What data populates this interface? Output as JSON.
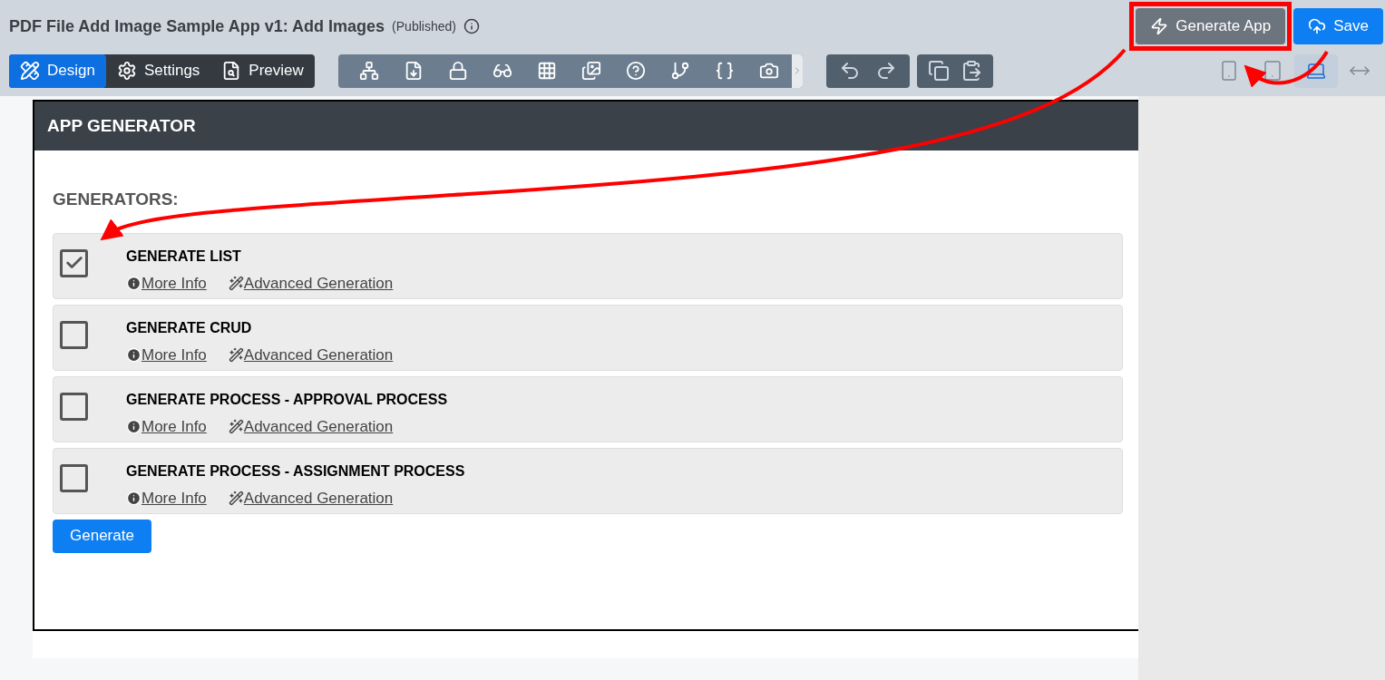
{
  "header": {
    "title": "PDF File Add Image Sample App v1: Add Images",
    "status": "(Published)"
  },
  "actions": [
    {
      "kind": "generate",
      "label": "Generate App",
      "highlighted": true
    },
    {
      "kind": "save",
      "label": "Save",
      "highlighted": false
    }
  ],
  "mode_tabs": [
    {
      "kind": "design",
      "label": "Design",
      "selected": true
    },
    {
      "kind": "settings",
      "label": "Settings",
      "selected": false
    },
    {
      "kind": "preview",
      "label": "Preview",
      "selected": false
    }
  ],
  "devices": [
    {
      "kind": "phone",
      "selected": false
    },
    {
      "kind": "tablet",
      "selected": false
    },
    {
      "kind": "laptop",
      "selected": true
    },
    {
      "kind": "full-width",
      "selected": false
    }
  ],
  "panel": {
    "title": "APP GENERATOR",
    "section": "GENERATORS:",
    "generators": [
      {
        "label": "GENERATE LIST",
        "checked": true,
        "more_info": "More Info",
        "advanced": "Advanced Generation"
      },
      {
        "label": "GENERATE CRUD",
        "checked": false,
        "more_info": "More Info",
        "advanced": "Advanced Generation"
      },
      {
        "label": "GENERATE PROCESS - APPROVAL PROCESS",
        "checked": false,
        "more_info": "More Info",
        "advanced": "Advanced Generation"
      },
      {
        "label": "GENERATE PROCESS - ASSIGNMENT PROCESS",
        "checked": false,
        "more_info": "More Info",
        "advanced": "Advanced Generation"
      }
    ],
    "button": "Generate"
  }
}
